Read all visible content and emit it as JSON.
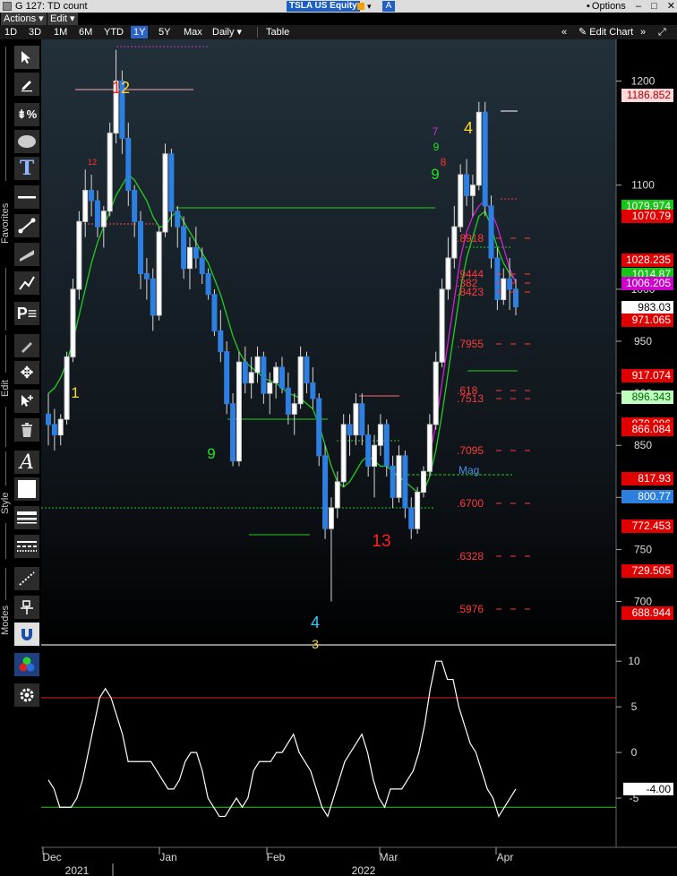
{
  "window": {
    "title": "G 127: TD count",
    "ticker": "TSLA US Equity",
    "a_label": "A",
    "options_label": "Options"
  },
  "menu": {
    "actions": "Actions",
    "edit": "Edit"
  },
  "ranges": [
    "1D",
    "3D",
    "1M",
    "6M",
    "YTD",
    "1Y",
    "5Y",
    "Max"
  ],
  "active_range": "1Y",
  "period": "Daily",
  "table_label": "Table",
  "edit_chart_label": "Edit Chart",
  "side_labels": {
    "favorites": "Favorites",
    "edit": "Edit",
    "style": "Style",
    "modes": "Modes"
  },
  "price_axis": [
    "1200",
    "1100",
    "1000",
    "950",
    "900",
    "850",
    "800",
    "750",
    "700"
  ],
  "osc_axis": [
    "10",
    "5",
    "0",
    "-5"
  ],
  "price_tags": [
    {
      "label": "1186.852",
      "bg": "#ffd9d9",
      "fg": "#b00000"
    },
    {
      "label": "1079.974",
      "bg": "#17c417",
      "fg": "#ffffff"
    },
    {
      "label": "1070.79",
      "bg": "#e00000",
      "fg": "#ffffff"
    },
    {
      "label": "1028.235",
      "bg": "#e00000",
      "fg": "#ffffff"
    },
    {
      "label": "1014.87",
      "bg": "#17c417",
      "fg": "#ffffff"
    },
    {
      "label": "1006.205",
      "bg": "#cc00cc",
      "fg": "#ffffff"
    },
    {
      "label": "983.03",
      "bg": "#ffffff",
      "fg": "#000000"
    },
    {
      "label": "971.065",
      "bg": "#e00000",
      "fg": "#ffffff"
    },
    {
      "label": "917.074",
      "bg": "#e00000",
      "fg": "#ffffff"
    },
    {
      "label": "896.343",
      "bg": "#bfffbf",
      "fg": "#006600"
    },
    {
      "label": "870.986",
      "bg": "#e00000",
      "fg": "#ffffff"
    },
    {
      "label": "866.084",
      "bg": "#e00000",
      "fg": "#ffffff"
    },
    {
      "label": "817.93",
      "bg": "#e00000",
      "fg": "#ffffff"
    },
    {
      "label": "800.77",
      "bg": "#2d7fe0",
      "fg": "#ffffff"
    },
    {
      "label": "772.453",
      "bg": "#e00000",
      "fg": "#ffffff"
    },
    {
      "label": "729.505",
      "bg": "#e00000",
      "fg": "#ffffff"
    },
    {
      "label": "688.944",
      "bg": "#e00000",
      "fg": "#ffffff"
    }
  ],
  "osc_tag": "-4.00",
  "fib_labels": [
    ".8918",
    ".9444",
    ".382",
    ".8423",
    ".7955",
    ".618",
    ".7513",
    ".7095",
    "Mag",
    ".6700",
    ".6328",
    ".5976"
  ],
  "td_labels": [
    "1",
    "2",
    "4",
    "9",
    "9",
    "13",
    "4",
    "3",
    "7",
    "9",
    "8",
    "12"
  ],
  "x_labels": [
    "Dec",
    "Jan",
    "Feb",
    "Mar",
    "Apr"
  ],
  "year_labels": [
    "2021",
    "2022"
  ],
  "colors": {
    "green": "#22cc22",
    "magenta": "#d020d0",
    "red": "#e00000",
    "blue": "#2d7fe0",
    "osc": "#ffffff"
  },
  "chart_data": {
    "type": "candlestick",
    "y_range": [
      660,
      1240
    ],
    "candles": [
      [
        880,
        900,
        850,
        870
      ],
      [
        870,
        885,
        845,
        860
      ],
      [
        860,
        880,
        850,
        875
      ],
      [
        875,
        940,
        870,
        935
      ],
      [
        935,
        1010,
        930,
        1000
      ],
      [
        1000,
        1075,
        990,
        1065
      ],
      [
        1065,
        1115,
        1050,
        1095
      ],
      [
        1095,
        1110,
        1070,
        1085
      ],
      [
        1085,
        1095,
        1050,
        1060
      ],
      [
        1060,
        1080,
        1040,
        1075
      ],
      [
        1075,
        1160,
        1070,
        1150
      ],
      [
        1150,
        1230,
        1140,
        1200
      ],
      [
        1200,
        1210,
        1130,
        1145
      ],
      [
        1145,
        1160,
        1080,
        1095
      ],
      [
        1095,
        1100,
        1050,
        1065
      ],
      [
        1065,
        1075,
        1000,
        1015
      ],
      [
        1015,
        1030,
        990,
        1010
      ],
      [
        1010,
        1020,
        960,
        975
      ],
      [
        975,
        1060,
        970,
        1055
      ],
      [
        1055,
        1140,
        1050,
        1130
      ],
      [
        1130,
        1135,
        1060,
        1075
      ],
      [
        1075,
        1080,
        1040,
        1060
      ],
      [
        1060,
        1070,
        1010,
        1020
      ],
      [
        1020,
        1050,
        1000,
        1040
      ],
      [
        1040,
        1060,
        1020,
        1030
      ],
      [
        1030,
        1040,
        1005,
        1015
      ],
      [
        1015,
        1020,
        990,
        995
      ],
      [
        995,
        1000,
        955,
        960
      ],
      [
        960,
        980,
        930,
        940
      ],
      [
        940,
        950,
        880,
        890
      ],
      [
        890,
        900,
        830,
        835
      ],
      [
        835,
        940,
        830,
        930
      ],
      [
        930,
        945,
        900,
        910
      ],
      [
        910,
        935,
        895,
        920
      ],
      [
        920,
        945,
        910,
        935
      ],
      [
        935,
        940,
        890,
        900
      ],
      [
        900,
        920,
        880,
        910
      ],
      [
        910,
        930,
        895,
        925
      ],
      [
        925,
        935,
        900,
        905
      ],
      [
        905,
        920,
        870,
        880
      ],
      [
        880,
        900,
        860,
        890
      ],
      [
        890,
        945,
        885,
        935
      ],
      [
        935,
        940,
        900,
        910
      ],
      [
        910,
        925,
        885,
        895
      ],
      [
        895,
        900,
        830,
        840
      ],
      [
        840,
        850,
        760,
        770
      ],
      [
        770,
        800,
        700,
        790
      ],
      [
        790,
        825,
        780,
        815
      ],
      [
        815,
        880,
        810,
        870
      ],
      [
        870,
        880,
        840,
        860
      ],
      [
        860,
        900,
        850,
        890
      ],
      [
        890,
        900,
        850,
        860
      ],
      [
        860,
        870,
        820,
        830
      ],
      [
        830,
        860,
        800,
        850
      ],
      [
        850,
        880,
        840,
        870
      ],
      [
        870,
        875,
        820,
        830
      ],
      [
        830,
        840,
        790,
        800
      ],
      [
        800,
        850,
        795,
        840
      ],
      [
        840,
        845,
        780,
        790
      ],
      [
        790,
        800,
        760,
        770
      ],
      [
        770,
        810,
        765,
        805
      ],
      [
        805,
        830,
        800,
        825
      ],
      [
        825,
        880,
        820,
        870
      ],
      [
        870,
        940,
        865,
        930
      ],
      [
        930,
        1010,
        925,
        1000
      ],
      [
        1000,
        1050,
        990,
        1030
      ],
      [
        1030,
        1080,
        1020,
        1060
      ],
      [
        1060,
        1120,
        1055,
        1110
      ],
      [
        1110,
        1125,
        1080,
        1090
      ],
      [
        1090,
        1110,
        1070,
        1100
      ],
      [
        1100,
        1180,
        1095,
        1170
      ],
      [
        1170,
        1180,
        1070,
        1080
      ],
      [
        1080,
        1090,
        1020,
        1030
      ],
      [
        1030,
        1040,
        980,
        990
      ],
      [
        990,
        1020,
        985,
        1010
      ],
      [
        1010,
        1030,
        980,
        1000
      ],
      [
        1000,
        1010,
        975,
        983
      ]
    ],
    "green_line": [
      900,
      905,
      915,
      930,
      950,
      975,
      1000,
      1025,
      1045,
      1060,
      1075,
      1090,
      1100,
      1110,
      1105,
      1095,
      1085,
      1070,
      1060,
      1060,
      1070,
      1075,
      1065,
      1055,
      1045,
      1035,
      1025,
      1010,
      995,
      975,
      955,
      940,
      930,
      925,
      920,
      915,
      912,
      910,
      905,
      900,
      898,
      895,
      890,
      885,
      870,
      850,
      830,
      815,
      810,
      815,
      825,
      835,
      840,
      835,
      830,
      830,
      825,
      820,
      815,
      810,
      805,
      805,
      820,
      845,
      880,
      920,
      960,
      1000,
      1030,
      1050,
      1070,
      1075,
      1060,
      1040,
      1025,
      1015,
      1008
    ],
    "magenta_line": [
      null,
      null,
      null,
      null,
      null,
      null,
      null,
      null,
      null,
      null,
      null,
      null,
      null,
      null,
      null,
      null,
      null,
      null,
      null,
      null,
      null,
      null,
      null,
      null,
      null,
      null,
      null,
      null,
      null,
      null,
      null,
      null,
      null,
      null,
      null,
      null,
      null,
      null,
      null,
      null,
      null,
      null,
      null,
      null,
      null,
      null,
      null,
      null,
      null,
      null,
      null,
      null,
      null,
      null,
      null,
      null,
      null,
      null,
      null,
      null,
      null,
      null,
      840,
      870,
      910,
      950,
      990,
      1030,
      1055,
      1070,
      1080,
      1085,
      1075,
      1060,
      1040,
      1020,
      1006
    ],
    "oscillator": [
      -3,
      -4,
      -6,
      -6,
      -6,
      -5,
      -3,
      0,
      3,
      6,
      7,
      6,
      4,
      2,
      -1,
      -1,
      -1,
      -1,
      -1,
      -2,
      -3,
      -4,
      -4,
      -3,
      -1,
      0,
      0,
      -2,
      -5,
      -6,
      -7,
      -7,
      -6,
      -5,
      -6,
      -5,
      -2,
      -1,
      -1,
      -1,
      0,
      0,
      1,
      2,
      0,
      -1,
      -2,
      -4,
      -6,
      -7,
      -5,
      -3,
      -1,
      0,
      1,
      2,
      0,
      -3,
      -5,
      -6,
      -4,
      -4,
      -4,
      -3,
      -2,
      0,
      3,
      7,
      10,
      10,
      8,
      8,
      5,
      3,
      1,
      0,
      -2,
      -4,
      -5,
      -7,
      -6,
      -5,
      -4
    ],
    "osc_range": [
      -10,
      11
    ],
    "osc_upper": 6,
    "osc_lower": -6
  }
}
